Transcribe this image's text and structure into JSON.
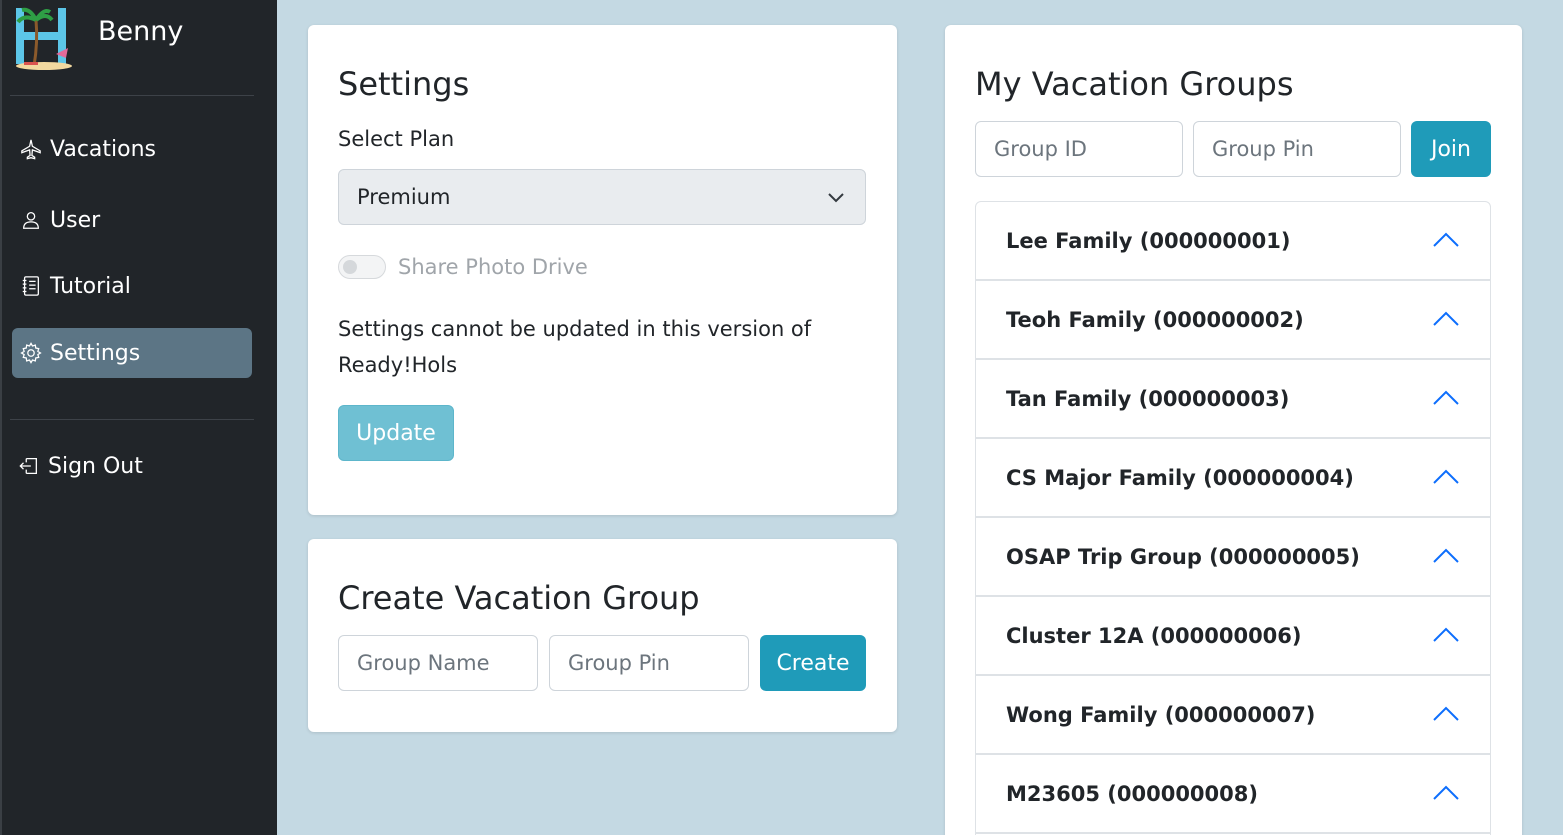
{
  "sidebar": {
    "brand": "Benny",
    "nav": [
      {
        "label": "Vacations",
        "icon": "airplane-icon"
      },
      {
        "label": "User",
        "icon": "person-icon"
      },
      {
        "label": "Tutorial",
        "icon": "journal-icon"
      },
      {
        "label": "Settings",
        "icon": "gear-icon"
      }
    ],
    "sign_out": "Sign Out",
    "active_color": "#5c7585",
    "background": "#212529"
  },
  "settings": {
    "title": "Settings",
    "select_label": "Select Plan",
    "plan_selected": "Premium",
    "toggle_label": "Share Photo Drive",
    "note": "Settings cannot be updated in this version of Ready!Hols",
    "update_label": "Update"
  },
  "create_group": {
    "title": "Create Vacation Group",
    "name_placeholder": "Group Name",
    "pin_placeholder": "Group Pin",
    "create_label": "Create"
  },
  "my_groups": {
    "title": "My Vacation Groups",
    "id_placeholder": "Group ID",
    "pin_placeholder": "Group Pin",
    "join_label": "Join",
    "groups": [
      {
        "label": "Lee Family (000000001)"
      },
      {
        "label": "Teoh Family (000000002)"
      },
      {
        "label": "Tan Family (000000003)"
      },
      {
        "label": "CS Major Family (000000004)"
      },
      {
        "label": "OSAP Trip Group (000000005)"
      },
      {
        "label": "Cluster 12A (000000006)"
      },
      {
        "label": "Wong Family (000000007)"
      },
      {
        "label": "M23605 (000000008)"
      }
    ]
  },
  "colors": {
    "page_background": "#c4d9e3",
    "info_button": "#1f9bb9",
    "chevron": "#0d6efd"
  }
}
